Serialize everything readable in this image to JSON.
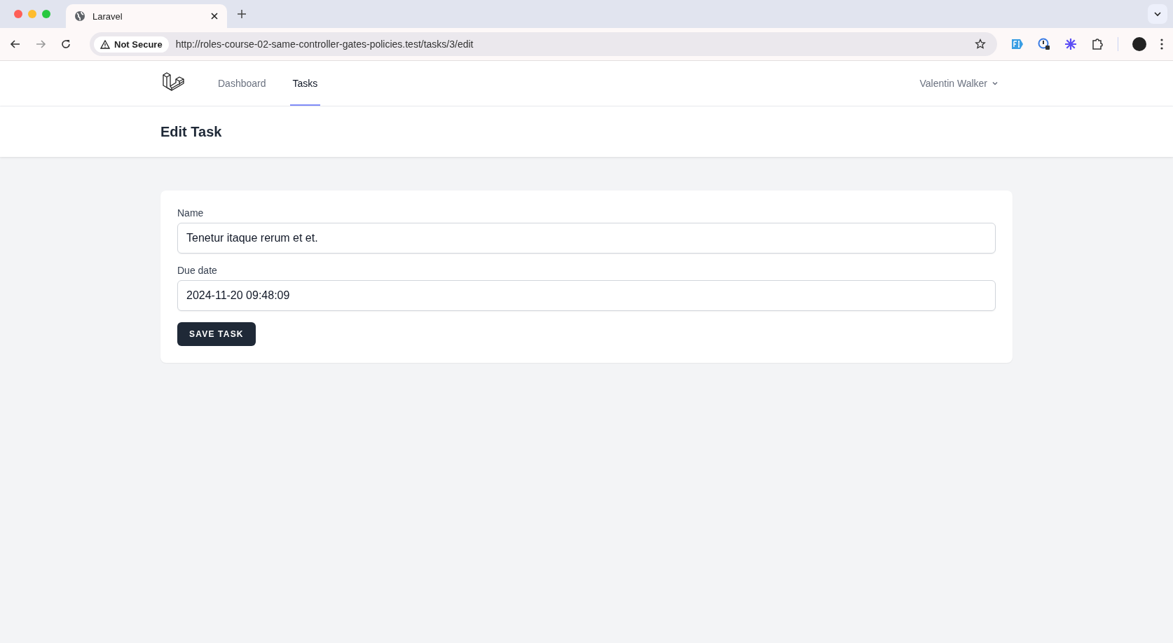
{
  "browser": {
    "tabs": [
      {
        "title": "Laravel",
        "selected": true
      }
    ],
    "security": "Not Secure",
    "url": "http://roles-course-02-same-controller-gates-policies.test/tasks/3/edit"
  },
  "nav": {
    "links": [
      {
        "label": "Dashboard",
        "selected": false
      },
      {
        "label": "Tasks",
        "selected": true
      }
    ],
    "user": "Valentin Walker"
  },
  "header": {
    "title": "Edit Task"
  },
  "form": {
    "fields": [
      {
        "label": "Name",
        "value": "Tenetur itaque rerum et et."
      },
      {
        "label": "Due date",
        "value": "2024-11-20 09:48:09"
      }
    ],
    "submit": "SAVE TASK"
  }
}
